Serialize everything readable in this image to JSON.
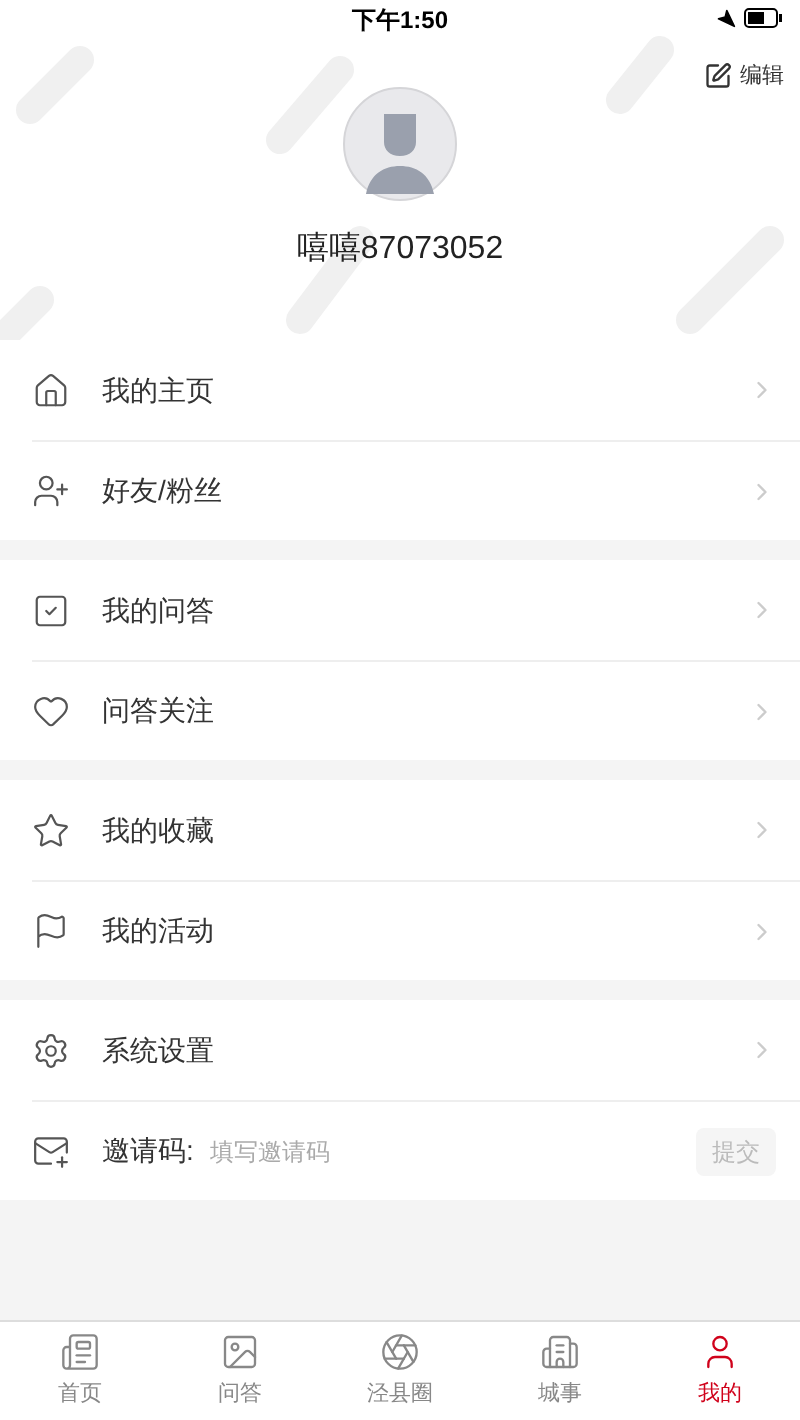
{
  "status_bar": {
    "time": "下午1:50"
  },
  "header": {
    "edit_label": "编辑",
    "username": "嘻嘻87073052"
  },
  "groups": [
    {
      "items": [
        {
          "kind": "link",
          "label": "我的主页"
        },
        {
          "kind": "link",
          "label": "好友/粉丝"
        }
      ]
    },
    {
      "items": [
        {
          "kind": "link",
          "label": "我的问答"
        },
        {
          "kind": "link",
          "label": "问答关注"
        }
      ]
    },
    {
      "items": [
        {
          "kind": "link",
          "label": "我的收藏"
        },
        {
          "kind": "link",
          "label": "我的活动"
        }
      ]
    },
    {
      "items": [
        {
          "kind": "link",
          "label": "系统设置"
        },
        {
          "kind": "invite",
          "label": "邀请码:",
          "placeholder": "填写邀请码",
          "button": "提交"
        }
      ]
    }
  ],
  "tab_bar": [
    {
      "label": "首页",
      "selected": false
    },
    {
      "label": "问答",
      "selected": false
    },
    {
      "label": "泾县圈",
      "selected": false
    },
    {
      "label": "城事",
      "selected": false
    },
    {
      "label": "我的",
      "selected": true
    }
  ]
}
